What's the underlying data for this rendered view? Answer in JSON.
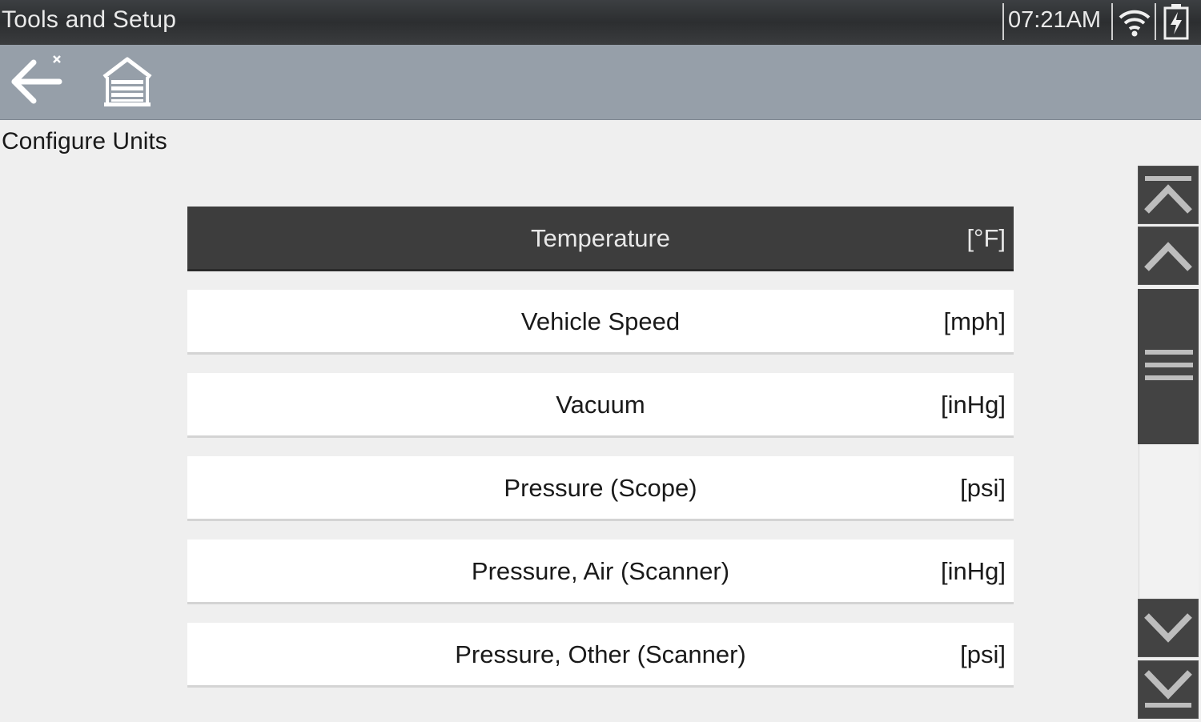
{
  "statusbar": {
    "title": "Tools and Setup",
    "time": "07:21AM",
    "wifi_icon": "wifi-icon",
    "battery_icon": "battery-charging-icon"
  },
  "toolbar": {
    "back_icon": "back-arrow-icon",
    "home_icon": "garage-home-icon"
  },
  "page": {
    "title": "Configure Units"
  },
  "units": [
    {
      "label": "Temperature",
      "value": "[°F]",
      "selected": true
    },
    {
      "label": "Vehicle Speed",
      "value": "[mph]",
      "selected": false
    },
    {
      "label": "Vacuum",
      "value": "[inHg]",
      "selected": false
    },
    {
      "label": "Pressure (Scope)",
      "value": "[psi]",
      "selected": false
    },
    {
      "label": "Pressure, Air (Scanner)",
      "value": "[inHg]",
      "selected": false
    },
    {
      "label": "Pressure, Other (Scanner)",
      "value": "[psi]",
      "selected": false
    }
  ],
  "scrollbar": {
    "top_icon": "scroll-to-top-icon",
    "up_icon": "scroll-up-icon",
    "down_icon": "scroll-down-icon",
    "bottom_icon": "scroll-to-bottom-icon"
  },
  "colors": {
    "statusbar_bg": "#2f3133",
    "toolbar_bg": "#969fa9",
    "selected_row_bg": "#3d3d3d",
    "row_bg": "#ffffff",
    "scroll_button_bg": "#434343"
  }
}
